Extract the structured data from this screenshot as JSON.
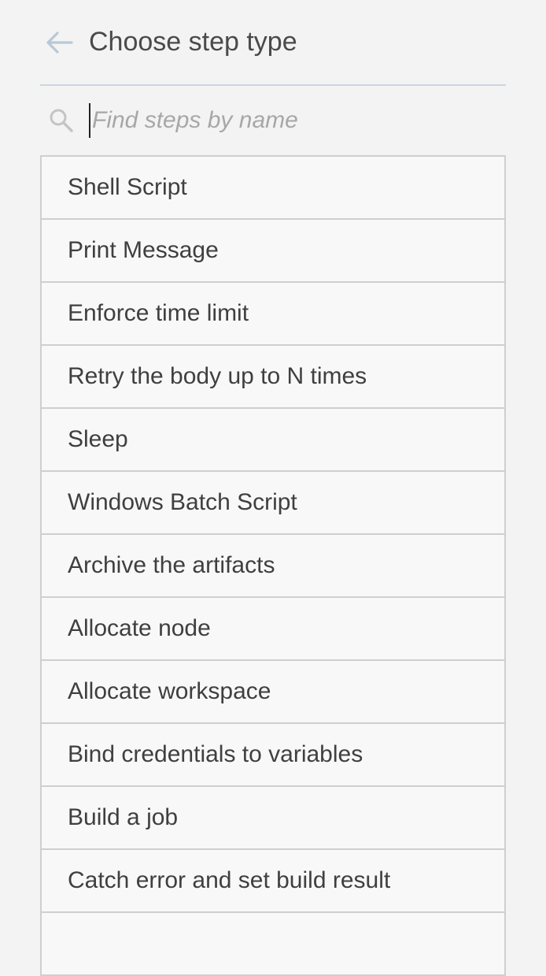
{
  "header": {
    "title": "Choose step type",
    "back_icon": "arrow-left-icon"
  },
  "search": {
    "placeholder": "Find steps by name",
    "value": "",
    "icon": "search-icon"
  },
  "steps": [
    {
      "label": "Shell Script"
    },
    {
      "label": "Print Message"
    },
    {
      "label": "Enforce time limit"
    },
    {
      "label": "Retry the body up to N times"
    },
    {
      "label": "Sleep"
    },
    {
      "label": "Windows Batch Script"
    },
    {
      "label": "Archive the artifacts"
    },
    {
      "label": "Allocate node"
    },
    {
      "label": "Allocate workspace"
    },
    {
      "label": "Bind credentials to variables"
    },
    {
      "label": "Build a job"
    },
    {
      "label": "Catch error and set build result"
    },
    {
      "label": ""
    }
  ],
  "colors": {
    "background": "#f3f3f3",
    "header_rule": "#c9d6e2",
    "back_arrow": "#b9c8d6",
    "border": "#cfcfcf",
    "text": "#3f3f3f",
    "placeholder": "#a7a7a7"
  }
}
